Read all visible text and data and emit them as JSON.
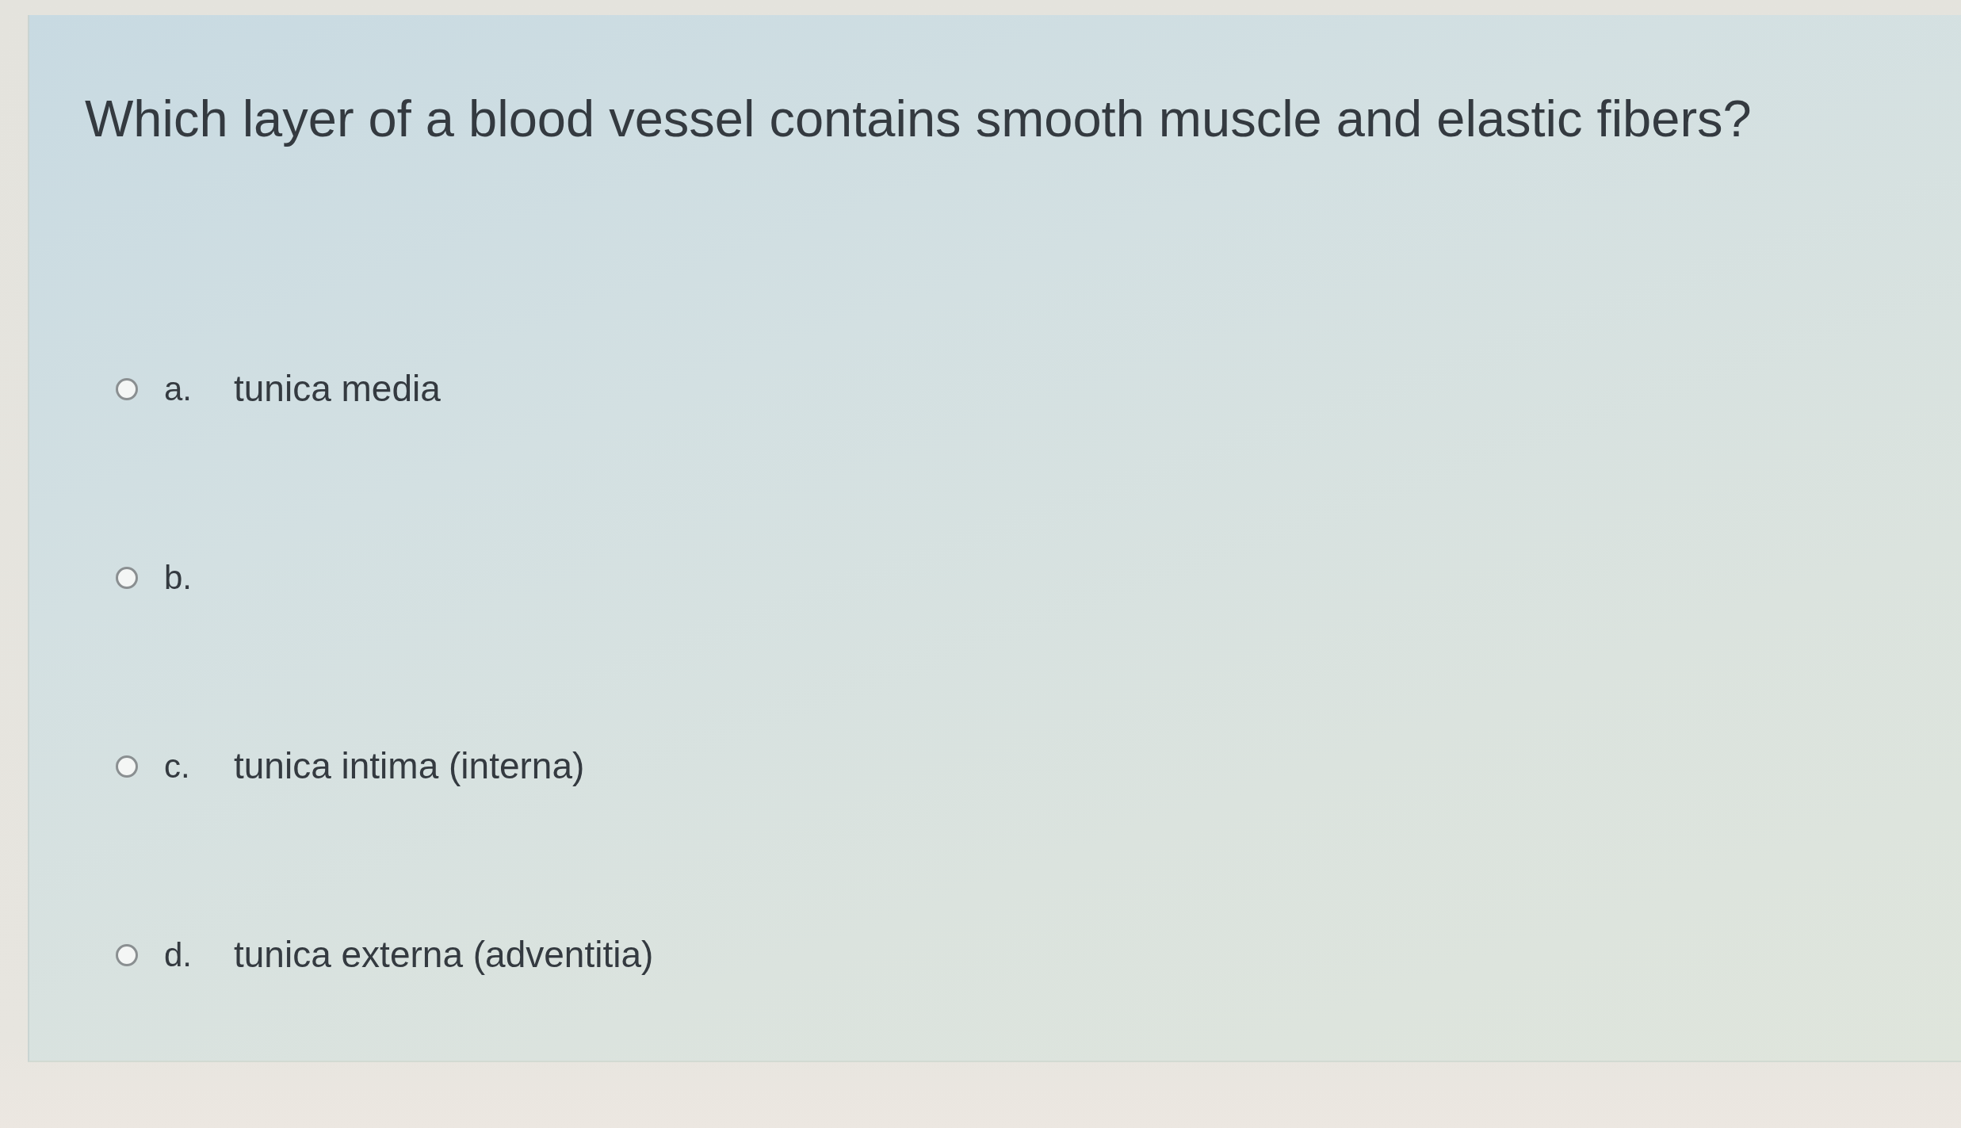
{
  "question": {
    "text": "Which layer of a blood vessel contains smooth muscle and elastic fibers?"
  },
  "options": [
    {
      "letter": "a.",
      "text": "tunica media",
      "selected": false
    },
    {
      "letter": "b.",
      "selected": false
    },
    {
      "letter": "c.",
      "text": "tunica intima (interna)",
      "selected": false
    },
    {
      "letter": "d.",
      "text": "tunica externa (adventitia)",
      "selected": false
    }
  ]
}
